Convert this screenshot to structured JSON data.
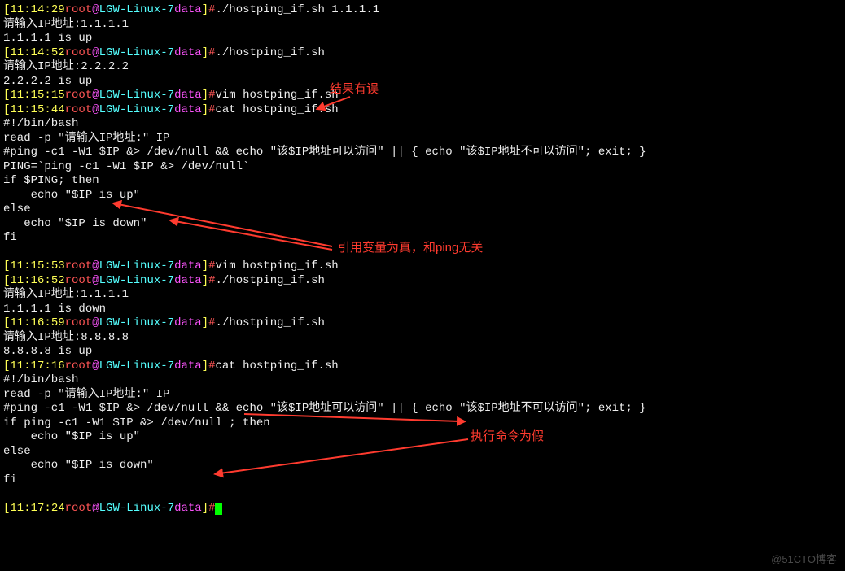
{
  "prompt": {
    "user": "root",
    "host": "LGW-Linux-7",
    "dir": "data",
    "lbr": "[",
    "rbr": "]",
    "at": "@",
    "hash": "#"
  },
  "times": {
    "t1": "11:14:29",
    "t2": "11:14:52",
    "t3": "11:15:15",
    "t4": "11:15:44",
    "t5": "11:15:53",
    "t6": "11:16:52",
    "t7": "11:16:59",
    "t8": "11:17:16",
    "t9": "11:17:24"
  },
  "cmds": {
    "run1": "./hostping_if.sh 1.1.1.1",
    "run2": "./hostping_if.sh",
    "vim": "vim hostping_if.sh",
    "cat": "cat hostping_if.sh"
  },
  "outputs": {
    "ask_ip": "请输入IP地址:",
    "ip1": "1.1.1.1",
    "ip2": "2.2.2.2",
    "ip3": "8.8.8.8",
    "up1": "1.1.1.1 is up",
    "up2": "2.2.2.2 is up",
    "down1": "1.1.1.1 is down",
    "up3": "8.8.8.8 is up"
  },
  "script1": {
    "l1": "#!/bin/bash",
    "l2": "read -p \"请输入IP地址:\" IP",
    "l3": "#ping -c1 -W1 $IP &> /dev/null && echo \"该$IP地址可以访问\" || { echo \"该$IP地址不可以访问\"; exit; }",
    "l4": "PING=`ping -c1 -W1 $IP &> /dev/null`",
    "l5": "if $PING; then",
    "l6": "    echo \"$IP is up\"",
    "l7": "else",
    "l8": "   echo \"$IP is down\"",
    "l9": "fi"
  },
  "script2": {
    "l1": "#!/bin/bash",
    "l2": "read -p \"请输入IP地址:\" IP",
    "l3": "#ping -c1 -W1 $IP &> /dev/null && echo \"该$IP地址可以访问\" || { echo \"该$IP地址不可以访问\"; exit; }",
    "l4": "if ping -c1 -W1 $IP &> /dev/null ; then",
    "l5": "    echo \"$IP is up\"",
    "l6": "else",
    "l7": "    echo \"$IP is down\"",
    "l8": "fi"
  },
  "annotations": {
    "a1": "结果有误",
    "a2": "引用变量为真，和ping无关",
    "a3": "执行命令为假"
  },
  "watermark": "@51CTO博客"
}
